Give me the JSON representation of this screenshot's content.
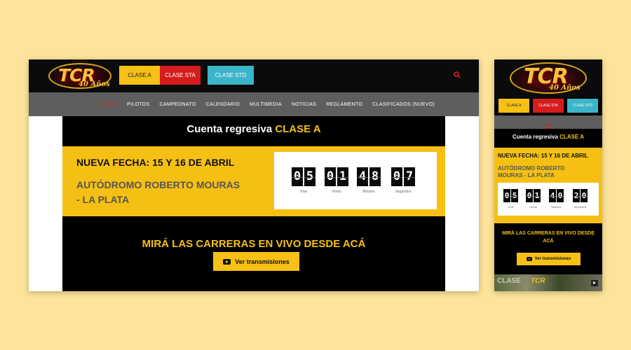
{
  "brand": {
    "logo_text": "TCR",
    "logo_sub": "40 Años"
  },
  "clases": [
    "CLASE A",
    "CLASE STA",
    "CLASE STD"
  ],
  "nav": [
    "INICIO",
    "PILOTOS",
    "CAMPEONATO",
    "CALENDARIO",
    "MULTIMEDIA",
    "NOTICIAS",
    "REGLAMENTO",
    "CLASIFICADOS (NUEVO)"
  ],
  "countdown": {
    "title_prefix": "Cuenta regresiva",
    "title_highlight": "CLASE A",
    "fecha": "NUEVA FECHA: 15 Y 16 DE ABRIL",
    "autodromo": "AUTÓDROMO ROBERTO MOURAS - LA PLATA",
    "desktop_digits": [
      "0",
      "5",
      "0",
      "1",
      "4",
      "8",
      "0",
      "7"
    ],
    "mobile_digits": [
      "0",
      "5",
      "0",
      "1",
      "4",
      "0",
      "2",
      "0"
    ],
    "labels": [
      "Días",
      "Horas",
      "Minutos",
      "Segundos"
    ]
  },
  "live": {
    "title": "MIRÁ LAS CARRERAS EN VIVO DESDE ACÁ",
    "button": "Ver transmisiones"
  },
  "mobile": {
    "video_text": "CLASE",
    "video_logo": "TCR"
  },
  "colors": {
    "accent_yellow": "#f6c014",
    "red": "#d61d1d",
    "cyan": "#3bb5c9",
    "nav_gray": "#5e5e5e",
    "background": "#fde49a"
  }
}
